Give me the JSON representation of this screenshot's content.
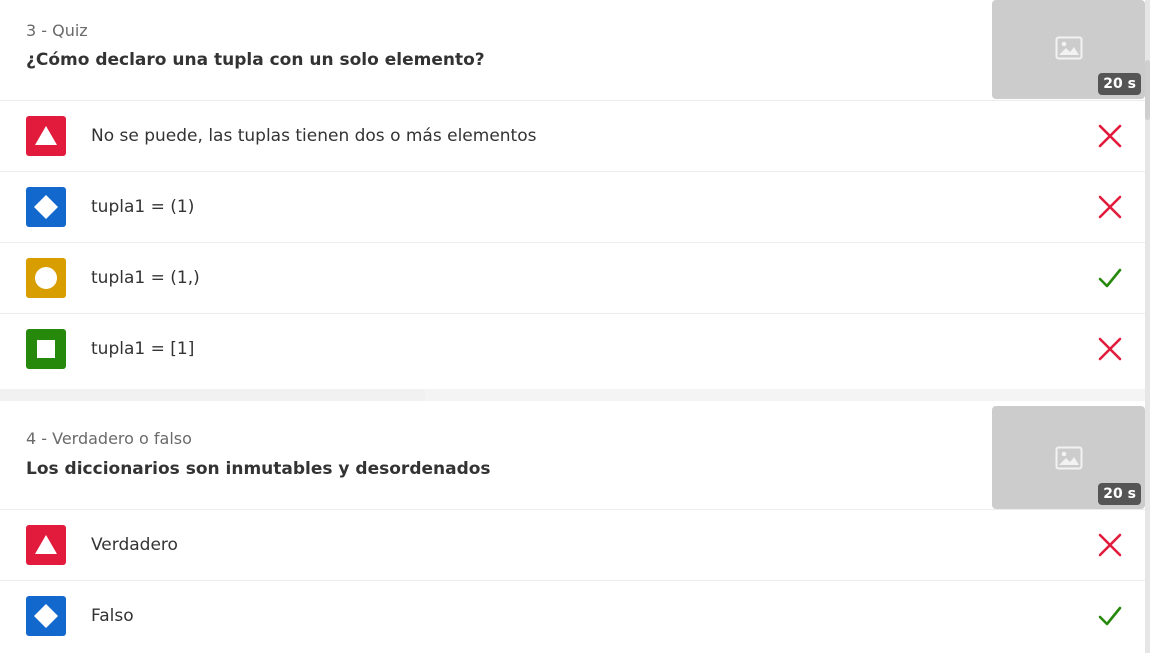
{
  "questions": [
    {
      "meta": "3 - Quiz",
      "title": "¿Cómo declaro una tupla con un solo elemento?",
      "time": "20 s",
      "answers": [
        {
          "shape": "triangle-icon",
          "color": "#e21b3c",
          "text": "No se puede, las tuplas tienen dos o más elementos",
          "correct": false
        },
        {
          "shape": "diamond-icon",
          "color": "#1368ce",
          "text": "tupla1 = (1)",
          "correct": false
        },
        {
          "shape": "circle-icon",
          "color": "#d89e00",
          "text": "tupla1 = (1,)",
          "correct": true
        },
        {
          "shape": "square-icon",
          "color": "#26890c",
          "text": "tupla1 = [1]",
          "correct": false
        }
      ]
    },
    {
      "meta": "4 - Verdadero o falso",
      "title": "Los diccionarios son inmutables y desordenados",
      "time": "20 s",
      "answers": [
        {
          "shape": "triangle-icon",
          "color": "#e21b3c",
          "text": "Verdadero",
          "correct": false
        },
        {
          "shape": "diamond-icon",
          "color": "#1368ce",
          "text": "Falso",
          "correct": true
        }
      ]
    }
  ],
  "colors": {
    "incorrect": "#e21b3c",
    "correct": "#26890c"
  }
}
